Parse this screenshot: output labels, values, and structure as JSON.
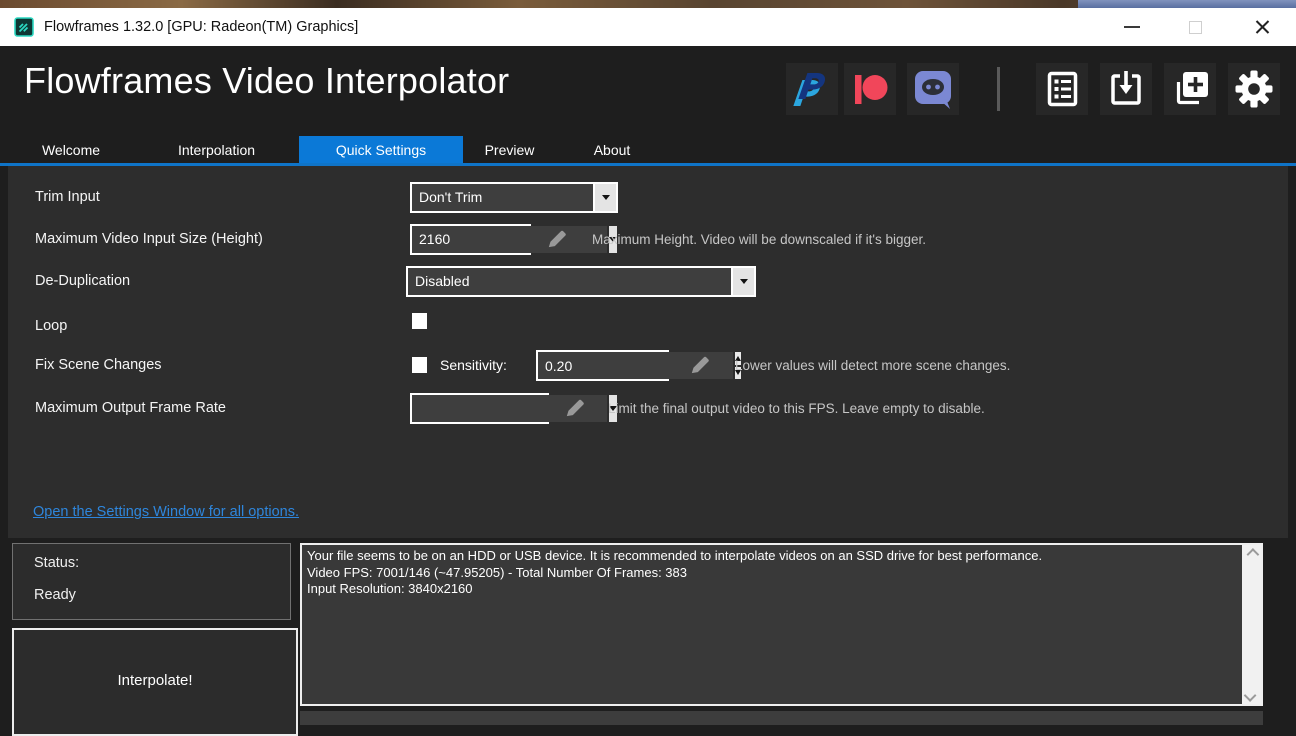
{
  "colors": {
    "accent_blue": "#0b79d7",
    "link_blue": "#2e86dc",
    "patreon_red": "#f1465a",
    "paypal_navy": "#14357f",
    "paypal_cyan": "#2ba6df",
    "discord_blurple": "#7b88d3",
    "flowframes_teal": "#2bd9c2",
    "panel_gray": "#2d2d2d"
  },
  "titlebar": {
    "title": "Flowframes 1.32.0 [GPU: Radeon(TM) Graphics]"
  },
  "header": {
    "app_title": "Flowframes Video Interpolator"
  },
  "tabs": [
    {
      "label": "Welcome",
      "active": false
    },
    {
      "label": "Interpolation",
      "active": false
    },
    {
      "label": "Quick Settings",
      "active": true
    },
    {
      "label": "Preview",
      "active": false
    },
    {
      "label": "About",
      "active": false
    }
  ],
  "form": {
    "trim_input": {
      "label": "Trim Input",
      "value": "Don't Trim"
    },
    "max_input_size": {
      "label": "Maximum Video Input Size (Height)",
      "value": "2160",
      "hint": "Maximum Height. Video will be downscaled if it's bigger."
    },
    "dedup": {
      "label": "De-Duplication",
      "value": "Disabled"
    },
    "loop": {
      "label": "Loop",
      "checked": false
    },
    "scene_changes": {
      "label": "Fix Scene Changes",
      "checked": false,
      "sensitivity_label": "Sensitivity:",
      "sensitivity_value": "0.20",
      "hint": "Lower values will detect more scene changes."
    },
    "max_output_fps": {
      "label": "Maximum Output Frame Rate",
      "value": "",
      "hint": "Limit the final output video to this FPS. Leave empty to disable."
    }
  },
  "settings_link": "Open the Settings Window for all options.",
  "status_panel": {
    "label": "Status:",
    "value": "Ready"
  },
  "interpolate_button": "Interpolate!",
  "log": {
    "lines": [
      "Your file seems to be on an HDD or USB device. It is recommended to interpolate videos on an SSD drive for best performance.",
      "Video FPS: 7001/146 (~47.95205) - Total Number Of Frames: 383",
      "Input Resolution: 3840x2160"
    ]
  }
}
